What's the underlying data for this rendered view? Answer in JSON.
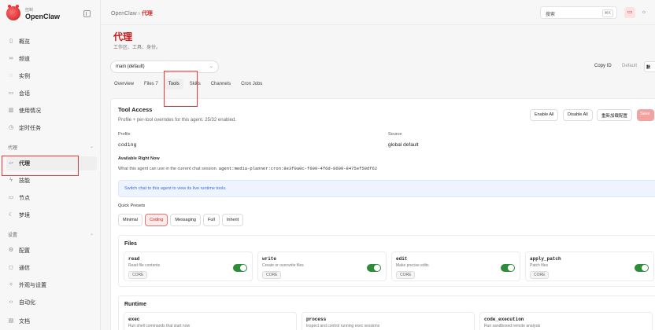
{
  "brand": {
    "sub": "控制",
    "name": "OpenClaw"
  },
  "sidebar": {
    "items_top": [
      {
        "label": "概览",
        "icon": "chart-icon"
      },
      {
        "label": "频道",
        "icon": "link-icon"
      },
      {
        "label": "实例",
        "icon": "radio-icon"
      },
      {
        "label": "会话",
        "icon": "document-icon"
      },
      {
        "label": "使用情况",
        "icon": "bar-chart-icon"
      },
      {
        "label": "定时任务",
        "icon": "clock-icon"
      }
    ],
    "section_agent": "代理",
    "items_agent": [
      {
        "label": "代理",
        "icon": "folder-icon"
      },
      {
        "label": "技能",
        "icon": "bolt-icon"
      },
      {
        "label": "节点",
        "icon": "monitor-icon"
      },
      {
        "label": "梦境",
        "icon": "moon-icon"
      }
    ],
    "section_settings": "设置",
    "items_settings": [
      {
        "label": "配置",
        "icon": "gear-icon"
      },
      {
        "label": "通信",
        "icon": "message-icon"
      },
      {
        "label": "外观与设置",
        "icon": "sparkle-icon"
      },
      {
        "label": "自动化",
        "icon": "code-icon"
      },
      {
        "label": "文档",
        "icon": "book-icon"
      }
    ]
  },
  "topbar": {
    "breadcrumb_root": "OpenClaw",
    "breadcrumb_sep": "›",
    "breadcrumb_current": "代理",
    "search_placeholder": "搜索",
    "search_kbd": "⌘K"
  },
  "page": {
    "title": "代理",
    "subtitle": "工作区、工具、身份。"
  },
  "agent_select": {
    "value": "main (default)"
  },
  "header_actions": {
    "copy_id": "Copy ID",
    "default": "Default",
    "edge_label": "默"
  },
  "tabs": [
    "Overview",
    "Files 7",
    "Tools",
    "Skills",
    "Channels",
    "Cron Jobs"
  ],
  "active_tab": "Tools",
  "tool_access": {
    "title": "Tool Access",
    "description": "Profile + per-tool overrides for this agent. 25/32 enabled.",
    "buttons": {
      "enable_all": "Enable All",
      "disable_all": "Disable All",
      "reload": "重新加载配置",
      "save": "Save"
    },
    "profile_label": "Profile",
    "profile_value": "coding",
    "source_label": "Source",
    "source_value": "global default",
    "available_label": "Available Right Now",
    "available_text": "What this agent can use in the current chat session.",
    "session_key": "agent:media-planner:cron:8e3f0a0c-f609-4f6d-8609-8475ef50df62",
    "banner": "Switch chat to this agent to view its live runtime tools.",
    "quick_presets_label": "Quick Presets",
    "presets": [
      "Minimal",
      "Coding",
      "Messaging",
      "Full",
      "Inherit"
    ],
    "active_preset": "Coding"
  },
  "files_section": {
    "title": "Files",
    "tools": [
      {
        "name": "read",
        "desc": "Read file contents",
        "badge": "CORE",
        "enabled": true
      },
      {
        "name": "write",
        "desc": "Create or overwrite files",
        "badge": "CORE",
        "enabled": true
      },
      {
        "name": "edit",
        "desc": "Make precise edits",
        "badge": "CORE",
        "enabled": true
      },
      {
        "name": "apply_patch",
        "desc": "Patch files",
        "badge": "CORE",
        "enabled": true
      }
    ]
  },
  "runtime_section": {
    "title": "Runtime",
    "tools": [
      {
        "name": "exec",
        "desc": "Run shell commands that start now"
      },
      {
        "name": "process",
        "desc": "Inspect and control running exec sessions"
      },
      {
        "name": "code_execution",
        "desc": "Run sandboxed remote analysis"
      }
    ]
  },
  "colors": {
    "accent": "#c41a1a",
    "toggle_on": "#2e8b3a",
    "highlight": "#e23b3b"
  }
}
